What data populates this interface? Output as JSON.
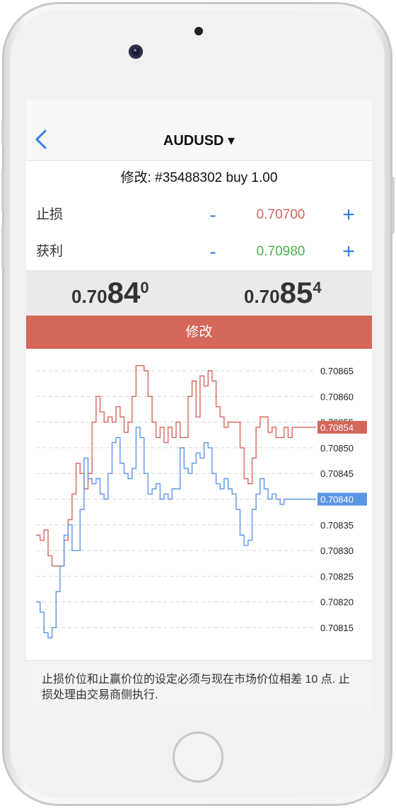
{
  "nav": {
    "back_icon": "chevron-left-icon",
    "title": "AUDUSD ▾"
  },
  "order_info": "修改: #35488302 buy 1.00",
  "stop_loss": {
    "label": "止损",
    "minus": "-",
    "value": "0.70700",
    "plus": "+",
    "color": "#d4665a"
  },
  "take_profit": {
    "label": "获利",
    "minus": "-",
    "value": "0.70980",
    "plus": "+",
    "color": "#4caf50"
  },
  "quotes": {
    "bid": {
      "prefix": "0.70",
      "big": "84",
      "sup": "0"
    },
    "ask": {
      "prefix": "0.70",
      "big": "85",
      "sup": "4"
    }
  },
  "modify_button": "修改",
  "footer_note": "止损价位和止赢价位的设定必须与现在市场价位相差 10 点. 止损处理由交易商侧执行.",
  "colors": {
    "accent": "#2f7fe4",
    "ask_line": "#d4665a",
    "bid_line": "#5b95e6"
  },
  "chart_data": {
    "type": "line",
    "ylim": [
      0.7081,
      0.70868
    ],
    "y_ticks": [
      "0.70865",
      "0.70860",
      "0.70855",
      "0.70850",
      "0.70845",
      "0.70840",
      "0.70835",
      "0.70830",
      "0.70825",
      "0.70820",
      "0.70815"
    ],
    "grid": true,
    "series": [
      {
        "role": "ask",
        "color": "#d4665a",
        "last_label": "0.70854",
        "values": [
          0.70833,
          0.70832,
          0.70834,
          0.70829,
          0.70827,
          0.70827,
          0.70827,
          0.70832,
          0.70836,
          0.70841,
          0.70847,
          0.70845,
          0.70842,
          0.70845,
          0.70855,
          0.7086,
          0.70857,
          0.70855,
          0.70856,
          0.70855,
          0.70858,
          0.70856,
          0.70853,
          0.70855,
          0.7086,
          0.70866,
          0.70866,
          0.70865,
          0.7086,
          0.70855,
          0.70852,
          0.70854,
          0.70851,
          0.70854,
          0.70852,
          0.70855,
          0.70852,
          0.70852,
          0.7086,
          0.70863,
          0.70856,
          0.70864,
          0.70862,
          0.70865,
          0.70863,
          0.70858,
          0.70856,
          0.70854,
          0.70855,
          0.70855,
          0.70855,
          0.7085,
          0.70844,
          0.70843,
          0.70848,
          0.70854,
          0.70856,
          0.70856,
          0.70853,
          0.70854,
          0.70852,
          0.70852,
          0.70854,
          0.70852,
          0.70854,
          0.70854,
          0.70854,
          0.70854,
          0.70854,
          0.70854,
          0.70854
        ]
      },
      {
        "role": "bid",
        "color": "#5b95e6",
        "last_label": "0.70840",
        "values": [
          0.7082,
          0.70818,
          0.70814,
          0.70813,
          0.70815,
          0.70822,
          0.70827,
          0.70833,
          0.70835,
          0.7083,
          0.7083,
          0.70838,
          0.70848,
          0.70844,
          0.70843,
          0.70844,
          0.70841,
          0.7084,
          0.70845,
          0.70851,
          0.70852,
          0.70847,
          0.70845,
          0.70844,
          0.70846,
          0.70854,
          0.70852,
          0.70845,
          0.70841,
          0.70842,
          0.70843,
          0.7084,
          0.70841,
          0.7084,
          0.70842,
          0.70842,
          0.7085,
          0.70846,
          0.70845,
          0.70847,
          0.70849,
          0.70848,
          0.70851,
          0.7085,
          0.70845,
          0.70843,
          0.70842,
          0.70844,
          0.70842,
          0.70841,
          0.70838,
          0.70833,
          0.70831,
          0.70832,
          0.70838,
          0.70841,
          0.70844,
          0.70842,
          0.7084,
          0.70841,
          0.7084,
          0.70839,
          0.7084,
          0.7084,
          0.7084,
          0.7084,
          0.7084,
          0.7084,
          0.7084,
          0.7084,
          0.7084
        ]
      }
    ]
  }
}
